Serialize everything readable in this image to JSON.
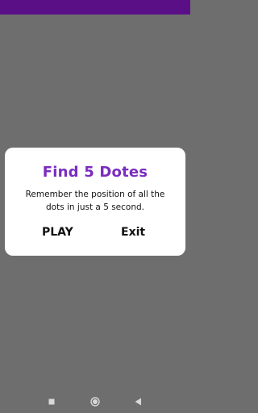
{
  "colors": {
    "status_bar": "#5a0f87",
    "overlay": "#6e6e6e",
    "dialog_bg": "#ffffff",
    "title": "#7a2cc0",
    "text": "#111111",
    "nav_icon": "#d9d9d9"
  },
  "dialog": {
    "title": "Find 5 Dotes",
    "message_line1": "Remember the position of all the",
    "message_line2": "dots in just a 5 second.",
    "play_label": "PLAY",
    "exit_label": "Exit"
  },
  "nav_bar": {
    "icons": [
      "square-recents-icon",
      "circle-home-icon",
      "triangle-back-icon"
    ]
  }
}
